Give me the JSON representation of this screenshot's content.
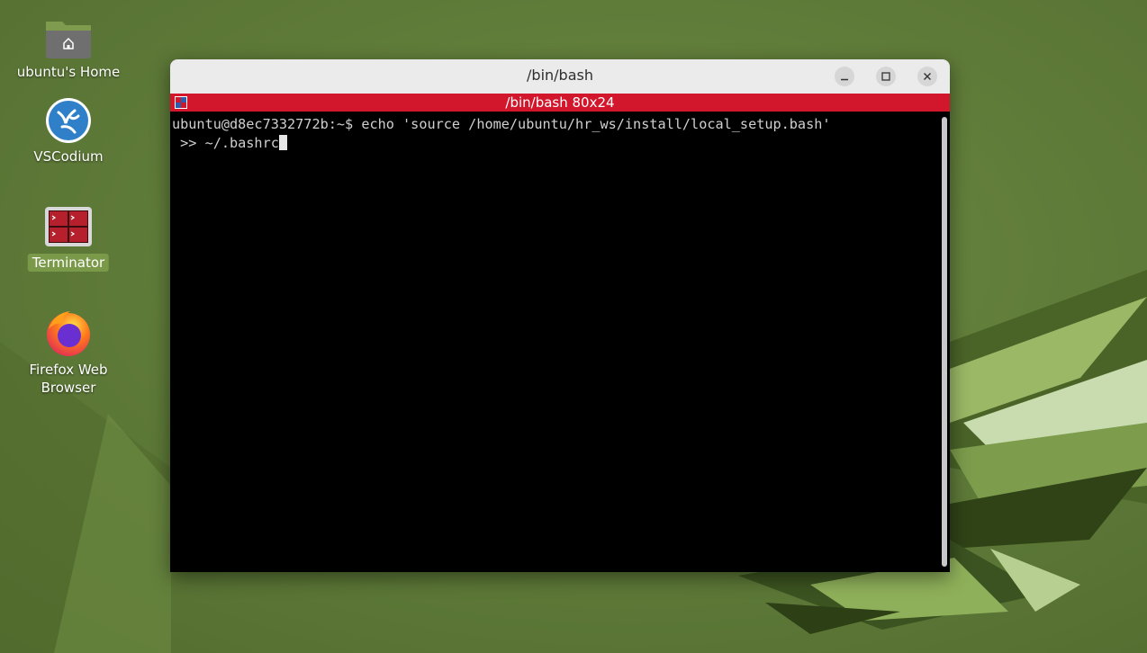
{
  "desktop": {
    "icons": [
      {
        "label": "ubuntu's Home",
        "icon": "home-folder-icon"
      },
      {
        "label": "VSCodium",
        "icon": "vscodium-icon"
      },
      {
        "label": "Terminator",
        "icon": "terminator-icon",
        "selected": true
      },
      {
        "label_line1": "Firefox Web",
        "label_line2": "Browser",
        "icon": "firefox-icon"
      }
    ]
  },
  "window": {
    "title": "/bin/bash",
    "buttons": {
      "minimize": "minimize-icon",
      "maximize": "maximize-icon",
      "close": "close-icon"
    },
    "tab_title": "/bin/bash 80x24",
    "tab_bar_color": "#d2172d",
    "terminal": {
      "prompt": "ubuntu@d8ec7332772b:~$",
      "command_line1": " echo 'source /home/ubuntu/hr_ws/install/local_setup.bash'",
      "command_line2": " >> ~/.bashrc"
    }
  }
}
